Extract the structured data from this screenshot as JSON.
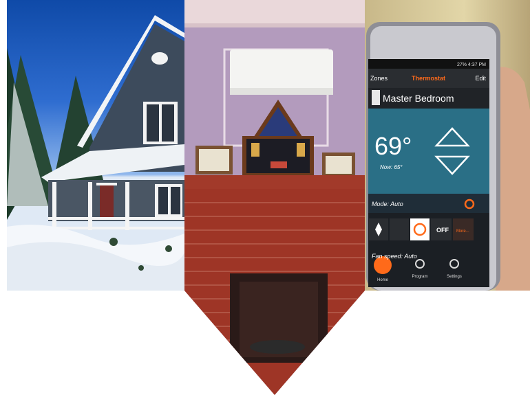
{
  "phone_screen": {
    "status_bar": "27% 4:37 PM",
    "back_label": "Zones",
    "title": "Thermostat",
    "edit_label": "Edit",
    "zone_name": "Master Bedroom",
    "temperature": "69°",
    "now_label": "Now: 65°",
    "mode_label": "Mode: Auto",
    "mode_buttons": [
      "OFF",
      "More..."
    ],
    "fan_speed_label": "Fan speed: Auto",
    "nav": [
      "Home",
      "Program",
      "Settings"
    ]
  },
  "colors": {
    "accent_orange": "#ff6a1a",
    "screen_blue": "#2a6f86",
    "screen_dark": "#1b1f24"
  }
}
